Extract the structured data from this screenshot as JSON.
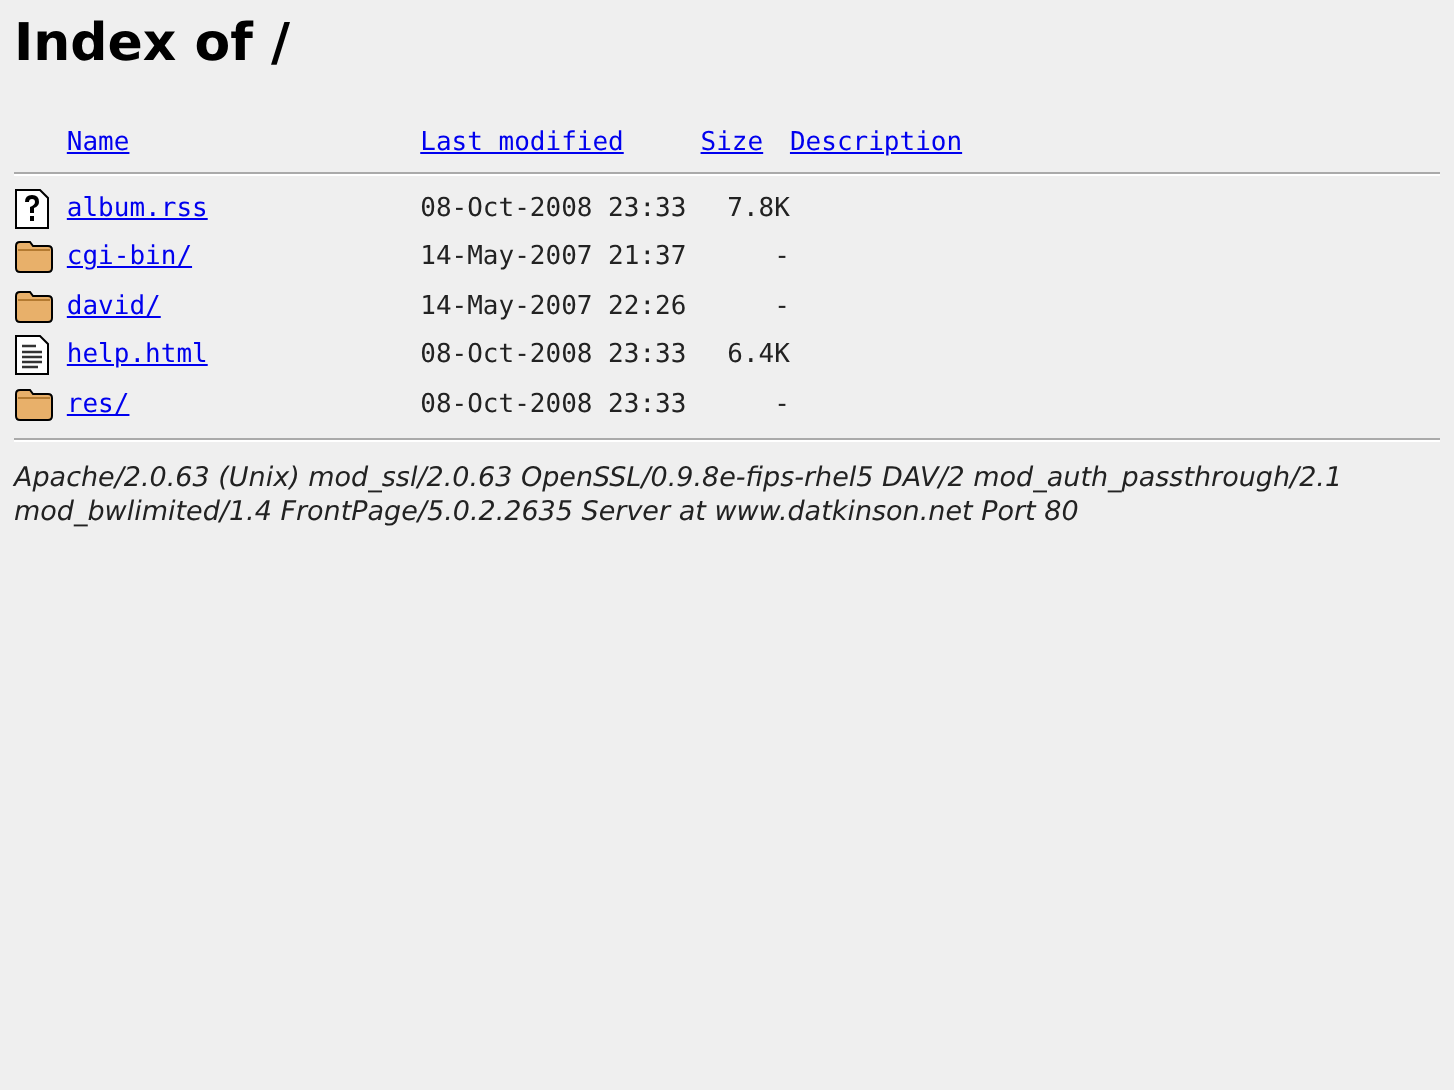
{
  "heading": "Index of /",
  "columns": [
    "Name",
    "Last modified",
    "Size",
    "Description"
  ],
  "rows": [
    {
      "kind": "unknown",
      "name": "album.rss",
      "modified": "08-Oct-2008 23:33",
      "size": "7.8K"
    },
    {
      "kind": "folder",
      "name": "cgi-bin/",
      "modified": "14-May-2007 21:37",
      "size": "-"
    },
    {
      "kind": "folder",
      "name": "david/",
      "modified": "14-May-2007 22:26",
      "size": "-"
    },
    {
      "kind": "text",
      "name": "help.html",
      "modified": "08-Oct-2008 23:33",
      "size": "6.4K"
    },
    {
      "kind": "folder",
      "name": "res/",
      "modified": "08-Oct-2008 23:33",
      "size": "-"
    }
  ],
  "address": "Apache/2.0.63 (Unix) mod_ssl/2.0.63 OpenSSL/0.9.8e-fips-rhel5 DAV/2 mod_auth_passthrough/2.1 mod_bwlimited/1.4 FrontPage/5.0.2.2635 Server at www.datkinson.net Port 80"
}
